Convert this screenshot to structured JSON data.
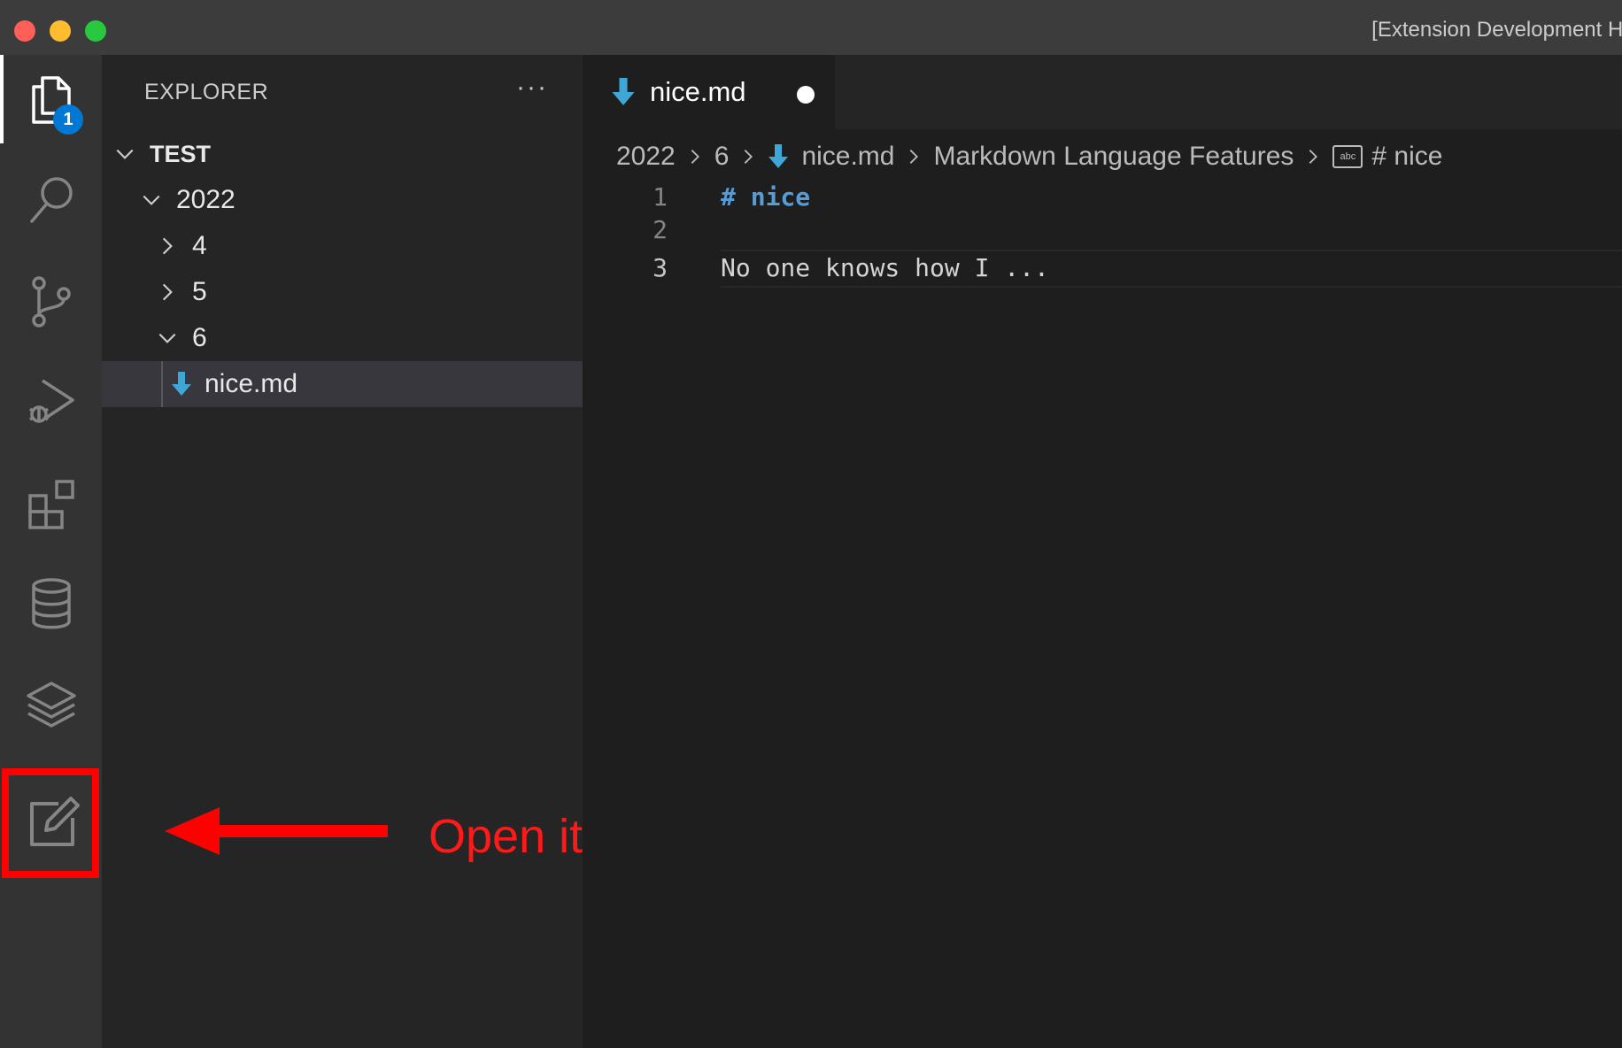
{
  "window": {
    "title": "[Extension Development Host]"
  },
  "activity_bar": {
    "explorer_badge": "1",
    "items": [
      "files-icon",
      "search-icon",
      "source-control-icon",
      "run-debug-icon",
      "extensions-icon",
      "database-icon",
      "layers-icon",
      "edit-note-icon"
    ]
  },
  "sidebar": {
    "header": "EXPLORER",
    "more": "···",
    "tree": {
      "root": "TEST",
      "folder_2022": "2022",
      "folder_4": "4",
      "folder_5": "5",
      "folder_6": "6",
      "file": "nice.md"
    }
  },
  "editor": {
    "tab": {
      "label": "nice.md",
      "dirty": true
    },
    "breadcrumb": {
      "b1": "2022",
      "b2": "6",
      "b3": "nice.md",
      "b4": "Markdown Language Features",
      "abc": "abc",
      "b5": "# nice"
    },
    "lines": {
      "n1": "1",
      "n2": "2",
      "n3": "3",
      "l1": "# nice",
      "l2": "",
      "l3": "No one knows how I ..."
    }
  },
  "annotation": {
    "text": "Open  it",
    "color": "#ff0000"
  },
  "colors": {
    "accent_blue": "#0078d4",
    "markdown_icon": "#3ea7d6",
    "heading": "#569cd6"
  }
}
